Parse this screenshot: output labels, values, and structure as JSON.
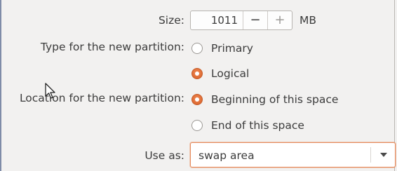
{
  "size": {
    "label": "Size:",
    "value": "1011",
    "decrement_glyph": "−",
    "increment_glyph": "+",
    "unit": "MB"
  },
  "type": {
    "label": "Type for the new partition:",
    "options": [
      {
        "label": "Primary",
        "checked": false
      },
      {
        "label": "Logical",
        "checked": true
      }
    ]
  },
  "location": {
    "label": "Location for the new partition:",
    "options": [
      {
        "label": "Beginning of this space",
        "checked": true
      },
      {
        "label": "End of this space",
        "checked": false
      }
    ]
  },
  "use_as": {
    "label": "Use as:",
    "selected": "swap area"
  },
  "colors": {
    "accent": "#dd6a33",
    "background": "#f2f1f0",
    "text": "#3c3c3c"
  },
  "icons": [
    "minus-icon",
    "plus-icon",
    "radio-icon",
    "dropdown-arrow-icon",
    "mouse-pointer-icon"
  ]
}
